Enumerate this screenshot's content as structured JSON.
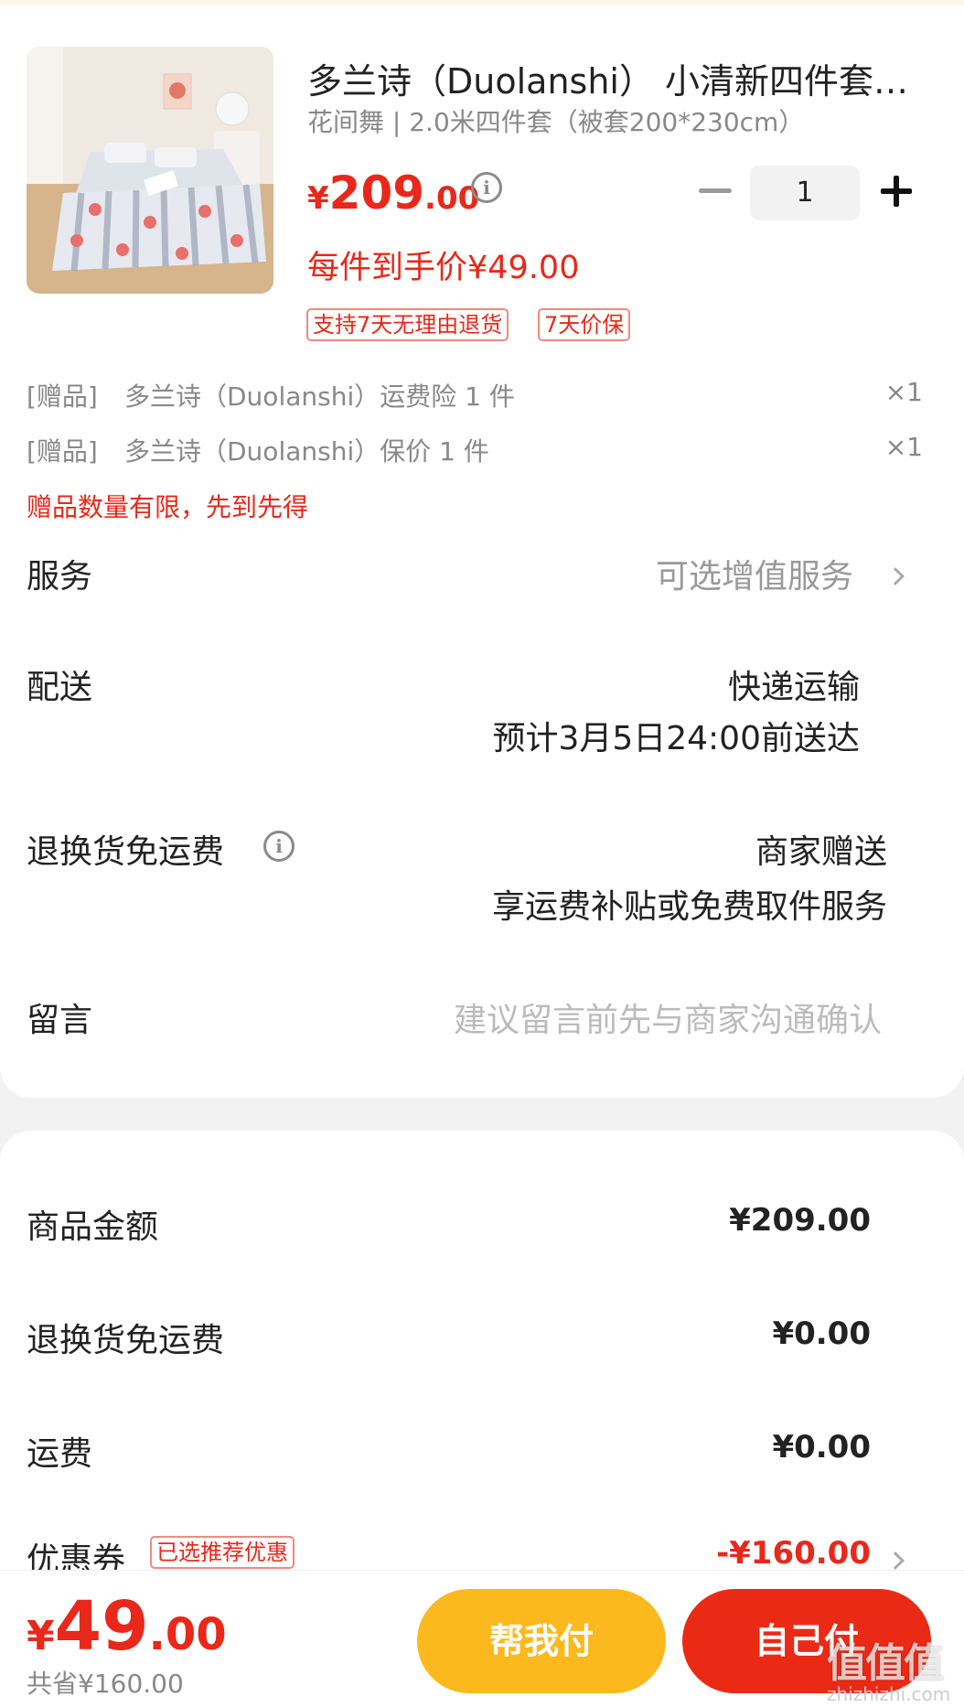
{
  "product": {
    "title": "多兰诗（Duolanshi） 小清新四件套…",
    "spec": "花间舞 | 2.0米四件套（被套200*230cm）",
    "price_symbol": "¥",
    "price_int": "209",
    "price_dec": ".00",
    "per_item_price": "每件到手价¥49.00",
    "quantity": "1",
    "tags": [
      "支持7天无理由退货",
      "7天价保"
    ]
  },
  "gifts": [
    {
      "label": "[赠品]",
      "name": "多兰诗（Duolanshi）运费险 1 件",
      "qty": "×1"
    },
    {
      "label": "[赠品]",
      "name": "多兰诗（Duolanshi）保价 1 件",
      "qty": "×1"
    }
  ],
  "gift_note": "赠品数量有限，先到先得",
  "service": {
    "label": "服务",
    "value": "可选增值服务"
  },
  "delivery": {
    "label": "配送",
    "method": "快递运输",
    "eta": "预计3月5日24:00前送达"
  },
  "return_shipping": {
    "label": "退换货免运费",
    "value": "商家赠送",
    "detail": "享运费补贴或免费取件服务"
  },
  "message": {
    "label": "留言",
    "placeholder": "建议留言前先与商家沟通确认"
  },
  "amounts": {
    "goods_label": "商品金额",
    "goods_value": "¥209.00",
    "return_label": "退换货免运费",
    "return_value": "¥0.00",
    "shipping_label": "运费",
    "shipping_value": "¥0.00",
    "coupon_label": "优惠券",
    "coupon_tag": "已选推荐优惠",
    "coupon_value": "-¥160.00"
  },
  "bottom": {
    "total_symbol": "¥",
    "total_int": "49",
    "total_dec": ".00",
    "saved": "共省¥160.00",
    "help_pay": "帮我付",
    "self_pay": "自己付"
  },
  "watermark": {
    "text": "值值值",
    "url": "zhizhizhi.com"
  },
  "colors": {
    "accent_red": "#e8281a",
    "button_yellow": "#fbb91e",
    "button_red": "#eb2a16"
  }
}
